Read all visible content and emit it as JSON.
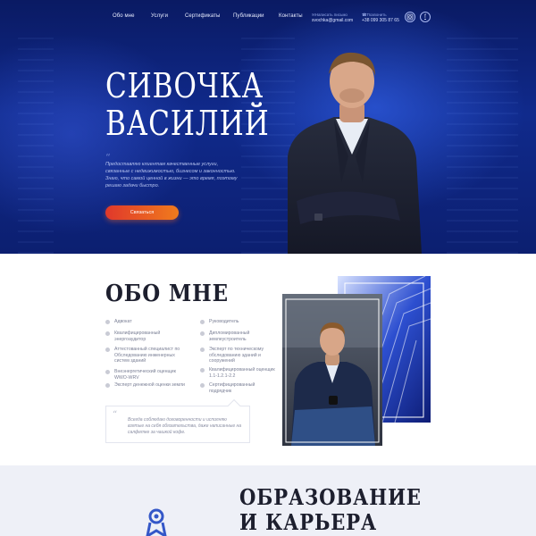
{
  "nav": {
    "items": [
      "Обо мне",
      "Услуги",
      "Сертификаты",
      "Публикации",
      "Контакты"
    ]
  },
  "contacts": {
    "email_label": "Написать письмо",
    "email": "svochka@gmail.com",
    "phone_label": "Позвонить",
    "phone": "+38 099 305 87 65"
  },
  "social": {
    "instagram_icon": "instagram-icon",
    "facebook_icon": "facebook-icon",
    "facebook_glyph": "f"
  },
  "hero": {
    "title_line1": "СИВОЧКА",
    "title_line2": "ВАСИЛИЙ",
    "quote_mark": "“",
    "text": "Предоставляю клиентам качественные услуги, связанные с недвижимостью, бизнесом и законностью. Знаю, что самой ценной в жизни — это время, поэтому решаю задачи быстро.",
    "cta_label": "Связаться"
  },
  "about": {
    "title": "ОБО МНЕ",
    "left_items": [
      "Адвокат",
      "Квалифицированный энергоаудитор",
      "Аттестованный специалист по Обследованию инженерных систем зданий",
      "Внеэнергетический оценщик WWO-WRV",
      "Эксперт денежной оценки земли"
    ],
    "right_items": [
      "Руководитель",
      "Дипломированный землеустроитель",
      "Эксперт по техническому обследованию зданий и сооружений",
      "Квалифицированный оценщик 1.1-1.2.1-2.2",
      "Сертифицированный подрядчик"
    ],
    "quote_mark": "“",
    "quote": "Всегда соблюдаю договоренности и исполняю взятые на себя обязательства, даже написанные на салфетке за чашкой кофе."
  },
  "education": {
    "title_line1": "ОБРАЗОВАНИЕ",
    "title_line2": "И КАРЬЕРА",
    "icon": "award-icon"
  },
  "colors": {
    "hero_dark": "#0a1a63",
    "hero_blue": "#102a8c",
    "cta_start": "#e0382b",
    "cta_end": "#f07b1d",
    "edu_bg": "#eef0f7",
    "heading": "#1d1f2e"
  }
}
